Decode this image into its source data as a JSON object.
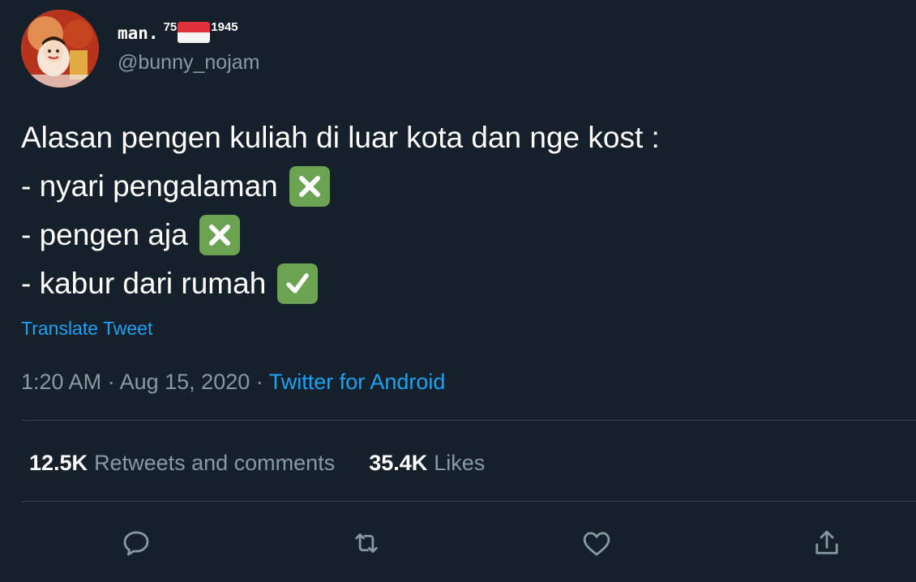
{
  "user": {
    "display_name": "man.",
    "display_name_sup_left": "75",
    "display_name_sup_right": "1945",
    "flag_icon": "indonesia-flag-icon",
    "handle": "@bunny_nojam",
    "avatar_icon": "avatar-image"
  },
  "tweet": {
    "lines": [
      {
        "text": "Alasan pengen kuliah di luar kota dan nge kost :",
        "emoji": ""
      },
      {
        "text": "- nyari pengalaman",
        "emoji": "cross-mark-icon"
      },
      {
        "text": "- pengen aja",
        "emoji": "cross-mark-icon"
      },
      {
        "text": "- kabur dari rumah",
        "emoji": "check-mark-icon"
      }
    ],
    "translate_label": "Translate Tweet"
  },
  "meta": {
    "time": "1:20 AM",
    "separator": "·",
    "date": "Aug 15, 2020",
    "source": "Twitter for Android"
  },
  "stats": {
    "retweets_count": "12.5K",
    "retweets_label": "Retweets and comments",
    "likes_count": "35.4K",
    "likes_label": "Likes"
  },
  "actions": {
    "icons": [
      "reply-icon",
      "retweet-icon",
      "like-icon",
      "share-icon"
    ]
  },
  "colors": {
    "background": "#15202b",
    "text": "#ffffff",
    "secondary_text": "#8899a6",
    "link": "#1da1f2",
    "divider": "#38444d",
    "emoji_box": "#6ba352"
  }
}
